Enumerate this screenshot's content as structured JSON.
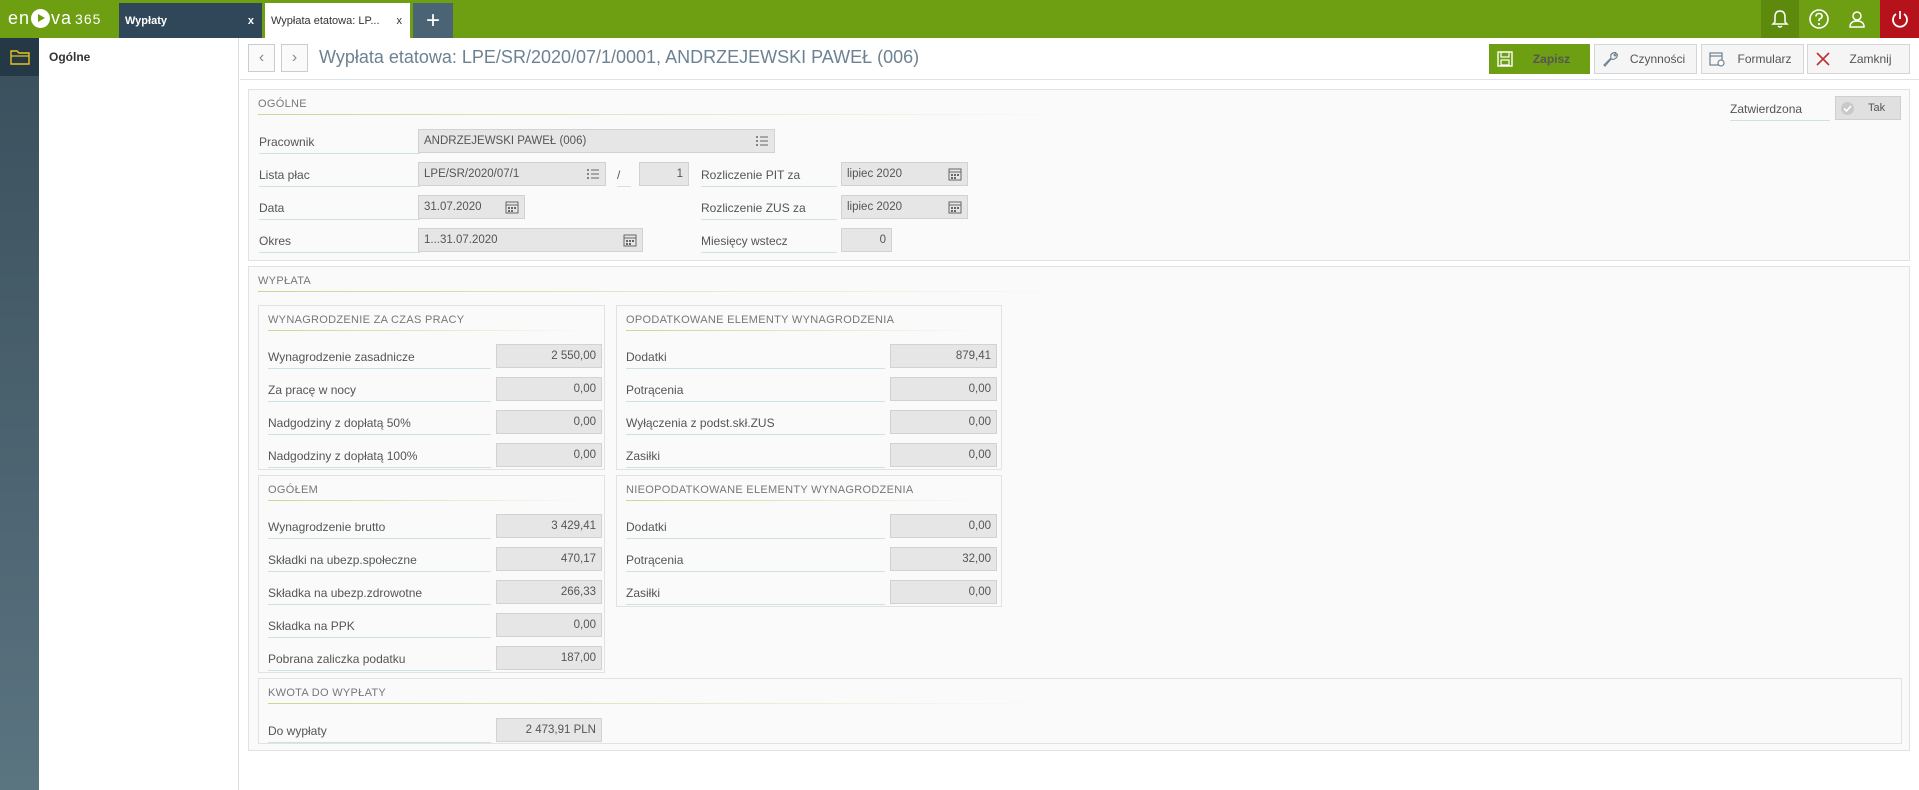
{
  "app": {
    "logo_left": "en",
    "logo_right": "va",
    "logo_num": "365"
  },
  "tabs": [
    {
      "label": "Wypłaty",
      "close": "x"
    },
    {
      "label": "Wypłata etatowa: LP...",
      "close": "x"
    }
  ],
  "tab_add": "+",
  "sidebar": {
    "title": "Ogólne"
  },
  "header": {
    "title": "Wypłata etatowa: LPE/SR/2020/07/1/0001, ANDRZEJEWSKI PAWEŁ (006)",
    "prev": "‹",
    "next": "›",
    "save": "Zapisz",
    "actions": "Czynności",
    "form": "Formularz",
    "close": "Zamknij"
  },
  "general": {
    "section": "OGÓLNE",
    "approved_label": "Zatwierdzona",
    "approved_value": "Tak",
    "employee_label": "Pracownik",
    "employee_value": "ANDRZEJEWSKI PAWEŁ (006)",
    "payroll_label": "Lista płac",
    "payroll_value": "LPE/SR/2020/07/1",
    "slash": "/",
    "payroll_no": "1",
    "date_label": "Data",
    "date_value": "31.07.2020",
    "period_label": "Okres",
    "period_value": "1...31.07.2020",
    "pit_label": "Rozliczenie PIT za",
    "pit_value": "lipiec 2020",
    "zus_label": "Rozliczenie ZUS za",
    "zus_value": "lipiec 2020",
    "months_label": "Miesięcy wstecz",
    "months_value": "0"
  },
  "payout": {
    "section": "WYPŁATA",
    "work": {
      "title": "WYNAGRODZENIE ZA CZAS PRACY",
      "rows": [
        {
          "label": "Wynagrodzenie zasadnicze",
          "value": "2 550,00"
        },
        {
          "label": "Za pracę w nocy",
          "value": "0,00"
        },
        {
          "label": "Nadgodziny z dopłatą 50%",
          "value": "0,00"
        },
        {
          "label": "Nadgodziny z dopłatą 100%",
          "value": "0,00"
        }
      ]
    },
    "taxed": {
      "title": "OPODATKOWANE ELEMENTY WYNAGRODZENIA",
      "rows": [
        {
          "label": "Dodatki",
          "value": "879,41"
        },
        {
          "label": "Potrącenia",
          "value": "0,00"
        },
        {
          "label": "Wyłączenia z podst.skł.ZUS",
          "value": "0,00"
        },
        {
          "label": "Zasiłki",
          "value": "0,00"
        }
      ]
    },
    "total": {
      "title": "OGÓŁEM",
      "rows": [
        {
          "label": "Wynagrodzenie brutto",
          "value": "3 429,41"
        },
        {
          "label": "Składki na ubezp.społeczne",
          "value": "470,17"
        },
        {
          "label": "Składka na ubezp.zdrowotne",
          "value": "266,33"
        },
        {
          "label": "Składka na PPK",
          "value": "0,00"
        },
        {
          "label": "Pobrana zaliczka podatku",
          "value": "187,00"
        }
      ]
    },
    "untaxed": {
      "title": "NIEOPODATKOWANE ELEMENTY WYNAGRODZENIA",
      "rows": [
        {
          "label": "Dodatki",
          "value": "0,00"
        },
        {
          "label": "Potrącenia",
          "value": "32,00"
        },
        {
          "label": "Zasiłki",
          "value": "0,00"
        }
      ]
    },
    "amount": {
      "title": "KWOTA DO WYPŁATY",
      "label": "Do wypłaty",
      "value": "2 473,91 PLN"
    }
  },
  "colors": {
    "brand": "#6e9e12",
    "power": "#b5121b",
    "tab_dark": "#2f4758"
  }
}
